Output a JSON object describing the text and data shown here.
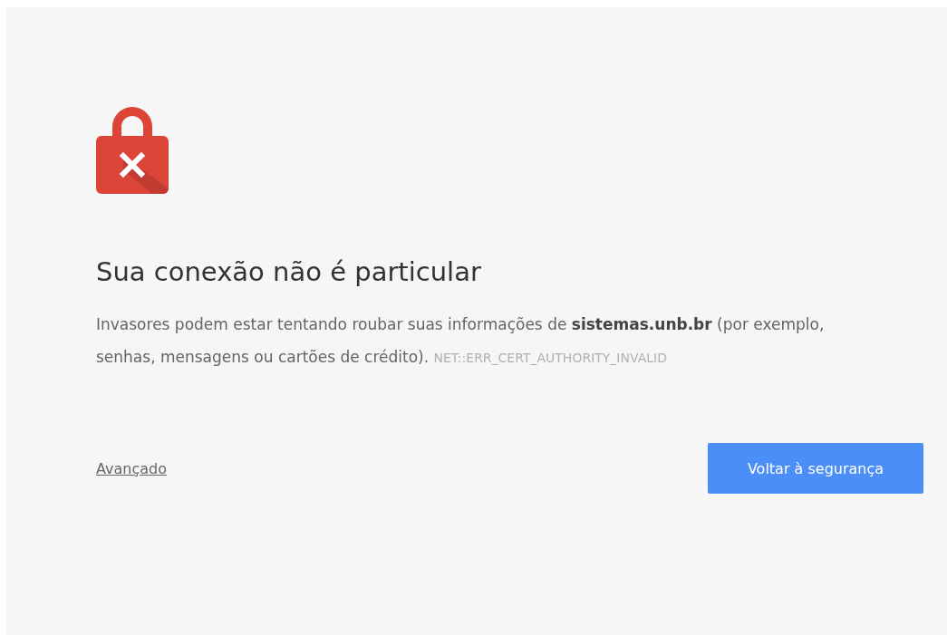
{
  "heading": "Sua conexão não é particular",
  "message": "Invasores podem estar tentando roubar suas informações de **sistemas.unb.br** (por exemplo, senhas, mensagens ou cartões de crédito).",
  "error_code": "NET::ERR_CERT_AUTHORITY_INVALID",
  "advanced_link": "Avançado",
  "back_button": "Voltar à segurança"
}
